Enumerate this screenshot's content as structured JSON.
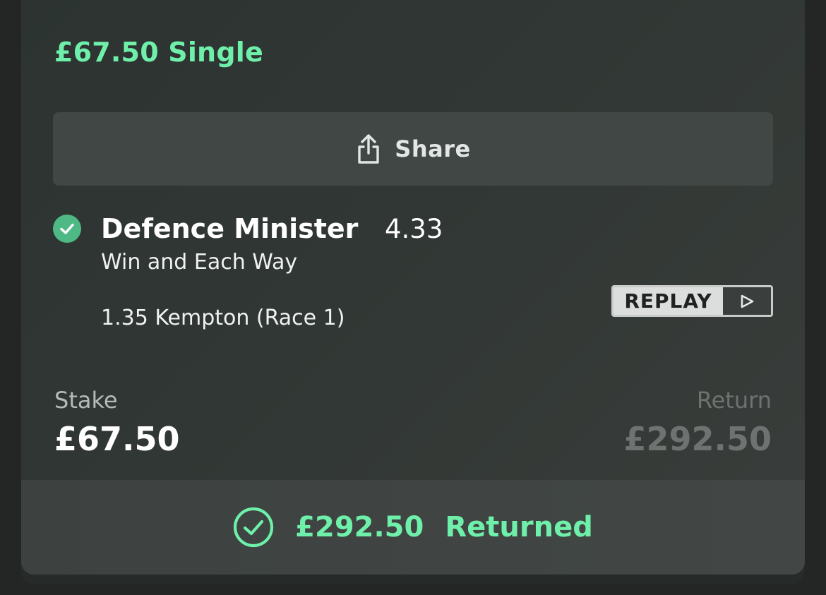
{
  "bet": {
    "title": "£67.50 Single",
    "share_label": "Share",
    "selection": {
      "name": "Defence Minister",
      "odds": "4.33",
      "market": "Win and Each Way",
      "event": "1.35 Kempton (Race 1)",
      "status_icon": "check-circle-filled-icon"
    },
    "replay_label": "REPLAY",
    "stake_label": "Stake",
    "stake_value": "£67.50",
    "return_label": "Return",
    "return_value": "£292.50",
    "returned": {
      "amount": "£292.50",
      "text": "Returned",
      "icon": "check-circle-outline-icon"
    }
  },
  "colors": {
    "accent_green": "#6ff0aa",
    "check_green": "#4fb985",
    "muted_grey": "#6e7371"
  }
}
